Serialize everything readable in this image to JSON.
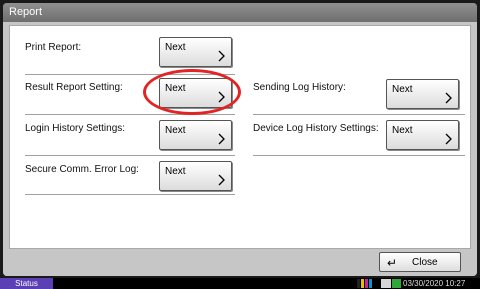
{
  "window": {
    "title": "Report"
  },
  "rows": [
    {
      "label": "Print Report:",
      "button": "Next"
    },
    {
      "label": "Result Report Setting:",
      "button": "Next"
    },
    {
      "label": "Sending Log History:",
      "button": "Next"
    },
    {
      "label": "Login History Settings:",
      "button": "Next"
    },
    {
      "label": "Device Log History Settings:",
      "button": "Next"
    },
    {
      "label": "Secure Comm. Error Log:",
      "button": "Next"
    }
  ],
  "footer": {
    "close_label": "Close",
    "close_icon": "return-arrow-icon"
  },
  "statusbar": {
    "status_label": "Status",
    "datetime": "03/30/2020 10:27",
    "toner_colors": [
      "#222222",
      "#e0c000",
      "#d0208a",
      "#1090d0"
    ]
  },
  "highlight_color": "#e32424"
}
